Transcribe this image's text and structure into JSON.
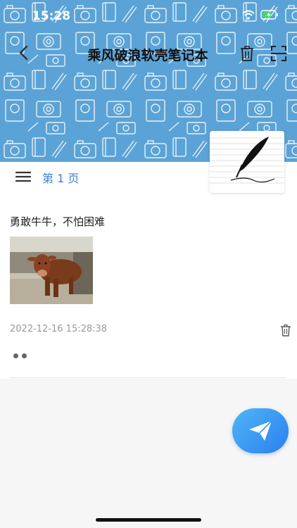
{
  "status_bar": {
    "time": "15:28"
  },
  "nav": {
    "title": "乘风破浪软壳笔记本",
    "back_icon": "chevron-left-icon",
    "trash_icon": "trash-icon",
    "scan_icon": "scan-icon"
  },
  "page": {
    "label": "第 1 页"
  },
  "note": {
    "text": "勇敢牛牛，不怕困难",
    "timestamp": "2022-12-16 15:28:38",
    "image_subject": "cow photo"
  },
  "colors": {
    "header_bg": "#5ba3d6",
    "accent": "#3d7fd1",
    "fab_start": "#4fb6f5",
    "fab_end": "#2b7ff0"
  },
  "fab": {
    "icon": "paper-plane-icon"
  }
}
